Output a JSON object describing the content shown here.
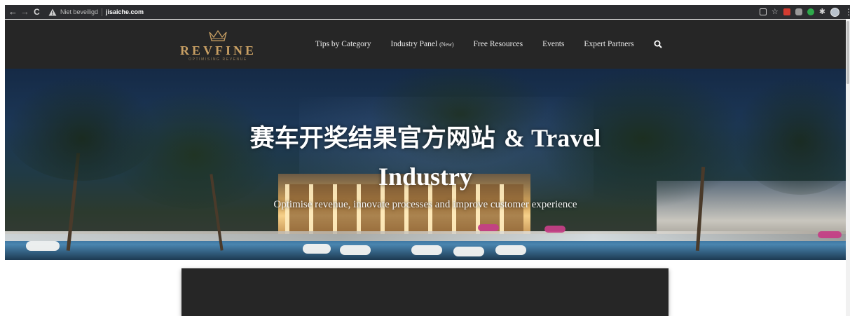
{
  "browser": {
    "security_text": "Niet beveiligd",
    "url": "jisaiche.com",
    "icons": [
      "back-icon",
      "forward-icon",
      "reload-icon",
      "warning-icon",
      "qr-icon",
      "star-icon",
      "extension-icons",
      "puzzle-icon",
      "avatar",
      "menu-icon"
    ]
  },
  "site": {
    "logo": {
      "name": "REVFINE",
      "tagline": "OPTIMISING REVENUE"
    },
    "nav": {
      "tips": "Tips by Category",
      "industry": "Industry Panel",
      "industry_badge": "(New)",
      "resources": "Free Resources",
      "events": "Events",
      "partners": "Expert Partners"
    }
  },
  "hero": {
    "title_cn": "赛车开奖结果官方网站",
    "title_en": "& Travel Industry",
    "title_line2": "Industry",
    "subtitle": "Optimise revenue, innovate processes and improve customer experience"
  },
  "colors": {
    "header_bg": "#262626",
    "logo_gold": "#c9a064",
    "chrome_bg": "#2b2c2f"
  }
}
